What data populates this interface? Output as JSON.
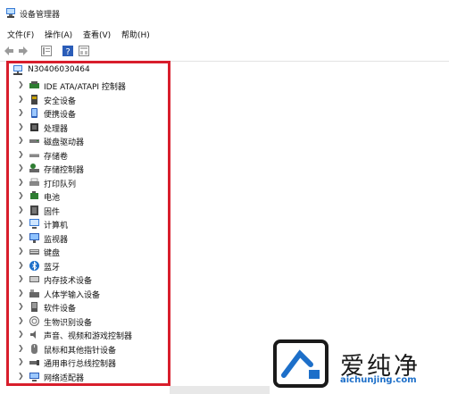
{
  "window": {
    "title": "设备管理器"
  },
  "menu": [
    {
      "label": "文件(F)"
    },
    {
      "label": "操作(A)"
    },
    {
      "label": "查看(V)"
    },
    {
      "label": "帮助(H)"
    }
  ],
  "toolbar": [
    "back-icon",
    "forward-icon",
    "properties-icon",
    "help-icon",
    "view-icon"
  ],
  "tree": {
    "root": "N30406030464",
    "items": [
      {
        "label": "IDE ATA/ATAPI 控制器",
        "icon": "ide-controller-icon"
      },
      {
        "label": "安全设备",
        "icon": "security-device-icon"
      },
      {
        "label": "便携设备",
        "icon": "portable-device-icon"
      },
      {
        "label": "处理器",
        "icon": "processor-icon"
      },
      {
        "label": "磁盘驱动器",
        "icon": "disk-drive-icon"
      },
      {
        "label": "存储卷",
        "icon": "storage-volume-icon"
      },
      {
        "label": "存储控制器",
        "icon": "storage-controller-icon"
      },
      {
        "label": "打印队列",
        "icon": "print-queue-icon"
      },
      {
        "label": "电池",
        "icon": "battery-icon"
      },
      {
        "label": "固件",
        "icon": "firmware-icon"
      },
      {
        "label": "计算机",
        "icon": "computer-icon"
      },
      {
        "label": "监视器",
        "icon": "monitor-icon"
      },
      {
        "label": "键盘",
        "icon": "keyboard-icon"
      },
      {
        "label": "蓝牙",
        "icon": "bluetooth-icon"
      },
      {
        "label": "内存技术设备",
        "icon": "memory-device-icon"
      },
      {
        "label": "人体学输入设备",
        "icon": "hid-icon"
      },
      {
        "label": "软件设备",
        "icon": "software-device-icon"
      },
      {
        "label": "生物识别设备",
        "icon": "biometric-icon"
      },
      {
        "label": "声音、视频和游戏控制器",
        "icon": "sound-icon"
      },
      {
        "label": "鼠标和其他指针设备",
        "icon": "mouse-icon"
      },
      {
        "label": "通用串行总线控制器",
        "icon": "usb-icon"
      },
      {
        "label": "网络适配器",
        "icon": "network-adapter-icon"
      }
    ]
  },
  "watermark": {
    "text": "爱纯净",
    "url": "aichunjing.com"
  },
  "colors": {
    "highlight": "#d81e2c",
    "accent": "#1d6fc9"
  }
}
